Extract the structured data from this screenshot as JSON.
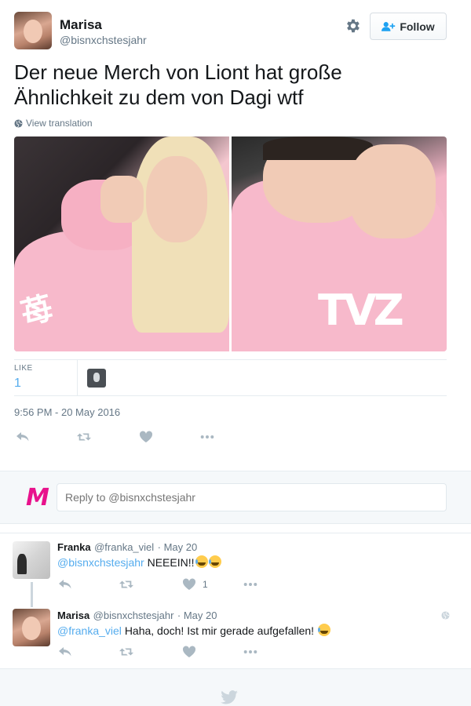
{
  "tweet": {
    "author_name": "Marisa",
    "author_handle": "@bisnxchstesjahr",
    "follow_label": "Follow",
    "text_line1": "Der neue Merch von Liont hat große",
    "text_line2": "Ähnlichkeit zu dem von Dagi wtf",
    "view_translation": "View translation",
    "like_label": "LIKE",
    "like_count": "1",
    "timestamp": "9:56 PM - 20 May 2016"
  },
  "reply_box": {
    "placeholder": "Reply to @bisnxchstesjahr"
  },
  "replies": [
    {
      "name": "Franka",
      "handle": "@franka_viel",
      "date": "· May 20",
      "mention": "@bisnxchstesjahr",
      "text": "NEEEIN!!",
      "like_count": "1"
    },
    {
      "name": "Marisa",
      "handle": "@bisnxchstesjahr",
      "date": "· May 20",
      "mention": "@franka_viel",
      "text": "Haha, doch! Ist mir gerade aufgefallen!",
      "like_count": ""
    }
  ],
  "colors": {
    "link": "#55acee",
    "brand_m": "#e8128c",
    "secondary_text": "#657786",
    "icon_gray": "#aab8c2"
  },
  "icons": [
    "gear-icon",
    "follow-user-icon",
    "globe-icon",
    "reply-icon",
    "retweet-icon",
    "like-icon",
    "more-icon",
    "twitter-bird-icon"
  ]
}
